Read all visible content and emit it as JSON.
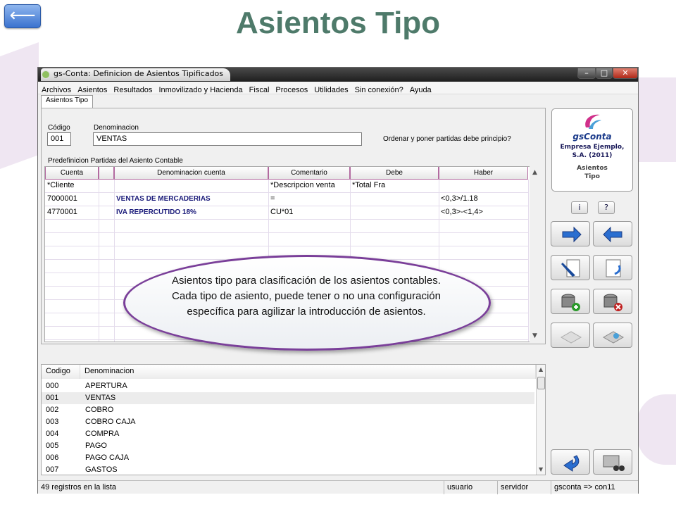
{
  "slide": {
    "title": "Asientos Tipo",
    "back_glyph": "⟵",
    "callout": "Asientos tipo para clasificación de los asientos contables. Cada tipo de asiento, puede tener o no una configuración específica para agilizar la introducción de asientos."
  },
  "window": {
    "title": "gs-Conta: Definicion de Asientos Tipificados",
    "menu": [
      "Archivos",
      "Asientos",
      "Resultados",
      "Inmovilizado y Hacienda",
      "Fiscal",
      "Procesos",
      "Utilidades",
      "Sin conexión?",
      "Ayuda"
    ],
    "tab": "Asientos Tipo"
  },
  "form": {
    "codigo_label": "Código",
    "codigo_value": "001",
    "denominacion_label": "Denominacion",
    "denominacion_value": "VENTAS",
    "checkbox_label": "Ordenar y poner partidas debe principio?",
    "section_label": "Predefinicion Partidas del Asiento Contable"
  },
  "grid": {
    "headers": [
      "Cuenta",
      "",
      "Denominacion cuenta",
      "Comentario",
      "Debe",
      "Haber"
    ],
    "rows": [
      [
        "*Cliente",
        "",
        "",
        "*Descripcion venta",
        "*Total Fra",
        ""
      ],
      [
        "7000001",
        "",
        "VENTAS DE MERCADERIAS",
        "=",
        "",
        "<0,3>/1.18"
      ],
      [
        "4770001",
        "",
        "IVA REPERCUTIDO 18%",
        "CU*01",
        "",
        "<0,3>-<1,4>"
      ]
    ]
  },
  "list": {
    "headers": [
      "Codigo",
      "Denominacion"
    ],
    "rows": [
      [
        "000",
        "APERTURA"
      ],
      [
        "001",
        "VENTAS"
      ],
      [
        "002",
        "COBRO"
      ],
      [
        "003",
        "COBRO CAJA"
      ],
      [
        "004",
        "COMPRA"
      ],
      [
        "005",
        "PAGO"
      ],
      [
        "006",
        "PAGO CAJA"
      ],
      [
        "007",
        "GASTOS"
      ]
    ]
  },
  "status": {
    "count": "49 registros en la lista",
    "user": "usuario",
    "server": "servidor",
    "db": "gsconta => con11"
  },
  "logo": {
    "brand": "gsConta",
    "company": "Empresa Ejemplo, S.A. (2011)",
    "module": "Asientos Tipo"
  },
  "icons": {
    "info": "i",
    "help": "?",
    "next": "arrow-right-icon",
    "prev": "arrow-left-icon"
  },
  "colors": {
    "title": "#4e7a6a",
    "callout_border": "#7a3f99",
    "bold_text": "#1a1a7a"
  }
}
